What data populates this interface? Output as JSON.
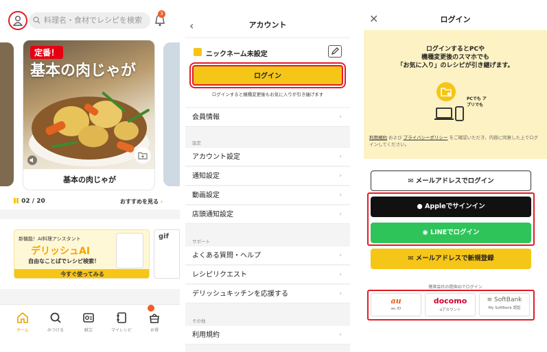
{
  "panel1": {
    "search_placeholder": "料理名・食材でレシピを検索",
    "bell_badge": "3",
    "featured": {
      "badge": "定番！",
      "title": "基本の肉じゃが",
      "name": "基本の肉じゃが"
    },
    "pager": "02 / 20",
    "see_more": "おすすめを見る",
    "banner": {
      "tag": "新機能！AI料理アシスタント",
      "title": "デリッシュAI",
      "subtitle": "自由なことばでレシピ検索！",
      "cta": "今すぐ使ってみる",
      "side_title": "gif"
    },
    "tabs": [
      {
        "label": "ホーム",
        "icon": "home-icon"
      },
      {
        "label": "みつける",
        "icon": "search-icon"
      },
      {
        "label": "献立",
        "icon": "menu-icon"
      },
      {
        "label": "マイレシピ",
        "icon": "notebook-icon"
      },
      {
        "label": "お得",
        "icon": "basket-icon"
      }
    ]
  },
  "panel2": {
    "title": "アカウント",
    "nickname": "ニックネーム未設定",
    "login_button": "ログイン",
    "login_note": "ログインすると機種変更後もお気に入りが引き継げます",
    "member_info": "会員情報",
    "settings_label": "設定",
    "settings": [
      "アカウント設定",
      "通知設定",
      "動画設定",
      "店頭通知設定"
    ],
    "support_label": "サポート",
    "support": [
      "よくある質問・ヘルプ",
      "レシピリクエスト",
      "デリッシュキッチンを応援する"
    ],
    "other_label": "その他",
    "other": [
      "利用規約"
    ]
  },
  "panel3": {
    "title": "ログイン",
    "promo_lines": [
      "ログインするとPCや",
      "機種変更後のスマホでも",
      "「お気に入り」のレシピが引き継げます。"
    ],
    "illus_text": "PCでも アプリでも",
    "legal_terms": "利用規約",
    "legal_and": " および ",
    "legal_privacy": "プライバシーポリシー",
    "legal_rest": " をご確認いただき、内容に同意した上でログインしてください。",
    "btn_email_login": "メールアドレスでログイン",
    "btn_apple": "Appleでサインイン",
    "btn_line": "LINEでログイン",
    "btn_email_register": "メールアドレスで新規登録",
    "carrier_note": "携帯会社の提供IDでログイン",
    "carriers": [
      {
        "logo": "au",
        "sub": "au ID",
        "color": "#eb5505"
      },
      {
        "logo": "docomo",
        "sub": "dアカウント",
        "color": "#cc0033"
      },
      {
        "logo": "≡ SoftBank",
        "sub": "My SoftBank 認証",
        "color": "#666666"
      }
    ]
  },
  "colors": {
    "accent_yellow": "#f5c518",
    "highlight_red": "#e21a26",
    "line_green": "#2ec45a"
  }
}
